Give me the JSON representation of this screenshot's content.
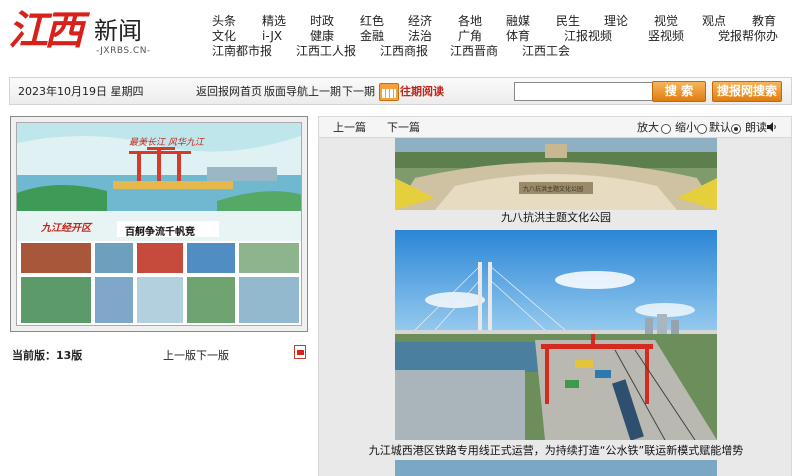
{
  "logo": {
    "name_red": "江西",
    "name_black": "新闻",
    "url": "-JXRBS.CN-"
  },
  "nav": {
    "row1": [
      "头条",
      "精选",
      "时政",
      "红色",
      "经济",
      "各地",
      "融媒",
      "民生",
      "理论",
      "视觉",
      "观点",
      "教育"
    ],
    "row2": [
      "文化",
      "i-JX",
      "健康",
      "金融",
      "法治",
      "广角",
      "体育",
      "江报视频",
      "竖视频",
      "党报帮你办"
    ],
    "row3": [
      "江南都市报",
      "江西工人报",
      "江西商报",
      "江西晋商",
      "江西工会"
    ]
  },
  "toolbar": {
    "date": "2023年10月19日 星期四",
    "home": "返回报网首页",
    "page_nav": "版面导航",
    "prev": "上一期",
    "next": "下一期",
    "history": "往期阅读",
    "search_value": "",
    "search_btn": "搜 索",
    "site_search_btn": "搜报网搜索"
  },
  "left": {
    "current_edition": "当前版：13版",
    "prev_edition": "上一版",
    "next_edition": "下一版",
    "thumb": {
      "headline": "百舸争流千帆竞",
      "section": "九江经开区",
      "banner": "最美长江 风华九江"
    }
  },
  "article": {
    "prev": "上一篇",
    "next": "下一篇",
    "zoom_in": "放大",
    "zoom_out": "缩小",
    "default": "默认",
    "read_aloud": "朗读",
    "captions": [
      "九八抗洪主题文化公园",
      "九江城西港区铁路专用线正式运营，为持续打造“公水铁”联运新模式赋能增势"
    ],
    "stone_inscription": "九八抗洪主题文化公园"
  },
  "colors": {
    "brand_red": "#d9211b",
    "orange": "#e07c10"
  }
}
